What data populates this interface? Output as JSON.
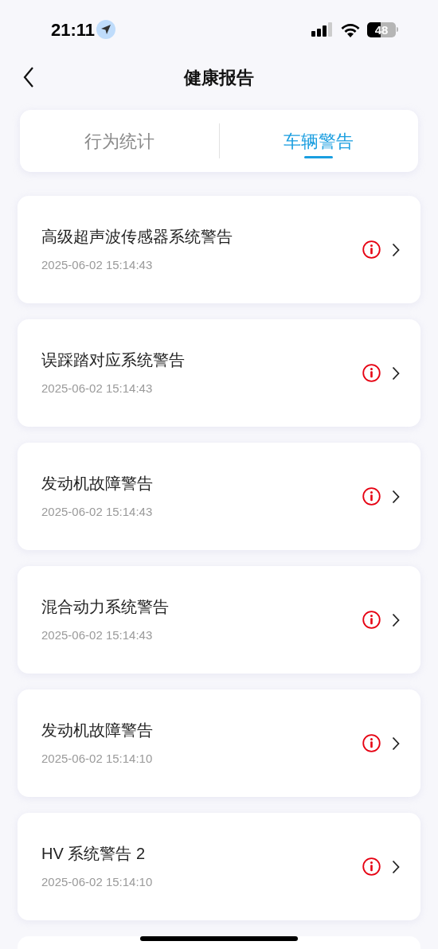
{
  "status_bar": {
    "time": "21:11",
    "battery": "48"
  },
  "nav": {
    "title": "健康报告"
  },
  "tabs": [
    {
      "label": "行为统计",
      "selected": false
    },
    {
      "label": "车辆警告",
      "selected": true
    }
  ],
  "warnings": [
    {
      "title": "高级超声波传感器系统警告",
      "time": "2025-06-02 15:14:43"
    },
    {
      "title": "误踩踏对应系统警告",
      "time": "2025-06-02 15:14:43"
    },
    {
      "title": "发动机故障警告",
      "time": "2025-06-02 15:14:43"
    },
    {
      "title": "混合动力系统警告",
      "time": "2025-06-02 15:14:43"
    },
    {
      "title": "发动机故障警告",
      "time": "2025-06-02 15:14:10"
    },
    {
      "title": "HV 系统警告 2",
      "time": "2025-06-02 15:14:10"
    }
  ]
}
